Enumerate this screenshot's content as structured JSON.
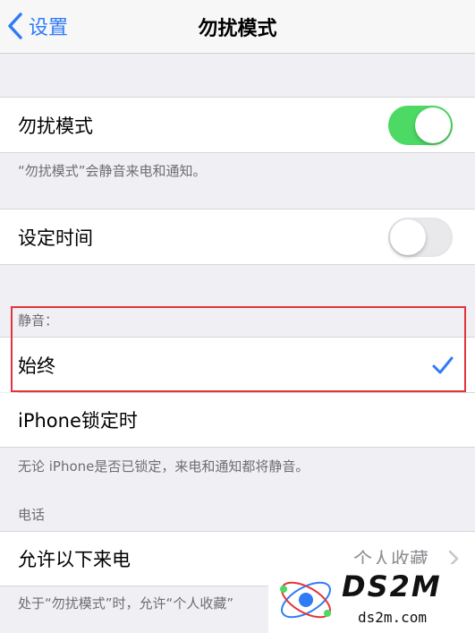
{
  "nav": {
    "back_label": "设置",
    "title": "勿扰模式"
  },
  "dnd": {
    "label": "勿扰模式",
    "enabled": true,
    "footnote": "“勿扰模式”会静音来电和通知。"
  },
  "scheduled": {
    "label": "设定时间",
    "enabled": false
  },
  "silence": {
    "header": "静音：",
    "options": [
      {
        "label": "始终",
        "selected": true
      },
      {
        "label": "iPhone锁定时",
        "selected": false
      }
    ],
    "footnote": "无论 iPhone是否已锁定，来电和通知都将静音。"
  },
  "phone": {
    "header": "电话",
    "allow_calls_label": "允许以下来电",
    "allow_calls_value": "个人收藏",
    "footnote": "处于“勿扰模式”时，允许“个人收藏”"
  },
  "watermark": {
    "text": "DS2M",
    "url": "ds2m.com"
  },
  "colors": {
    "accent": "#2f7cf6",
    "toggle_on": "#4cd964",
    "highlight": "#e0353b"
  }
}
